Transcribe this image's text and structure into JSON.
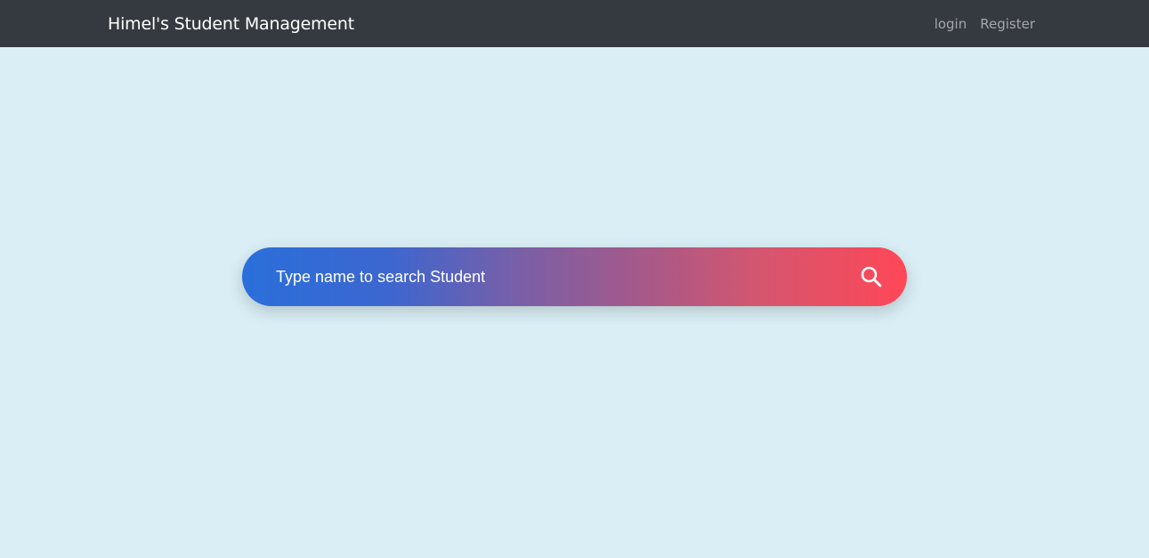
{
  "navbar": {
    "brand": "Himel's Student Management",
    "links": [
      {
        "label": "login"
      },
      {
        "label": "Register"
      }
    ]
  },
  "search": {
    "placeholder": "Type name to search Student",
    "value": "",
    "icon": "search-icon"
  },
  "colors": {
    "page_background": "#d9eef5",
    "navbar_background": "#343a40",
    "gradient_start": "#2a6fdb",
    "gradient_end": "#ff4757"
  }
}
